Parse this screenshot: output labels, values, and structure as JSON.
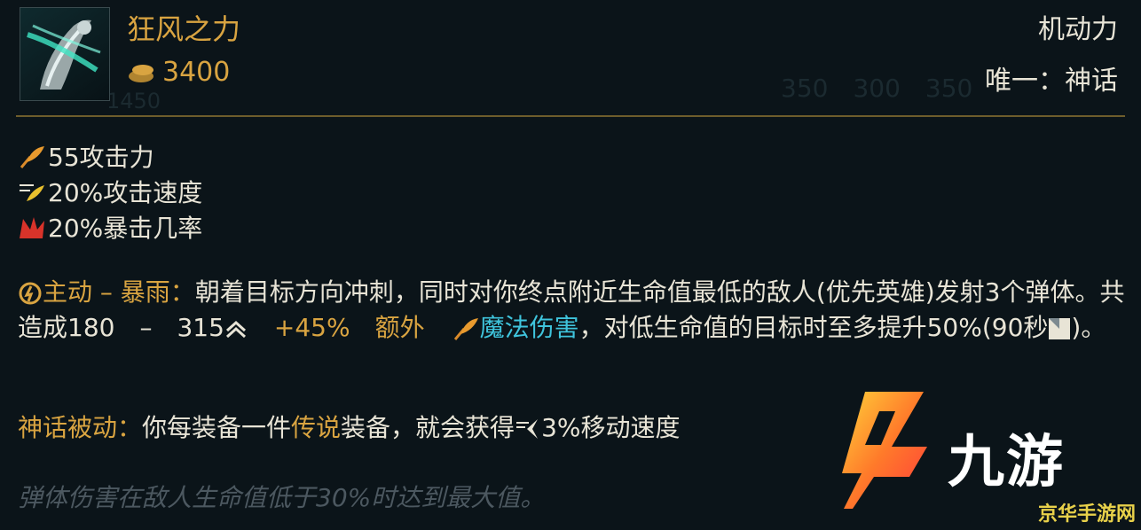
{
  "item": {
    "name": "狂风之力",
    "cost": "3400",
    "category": "机动力",
    "unique_tag": "唯一：神话"
  },
  "stats": [
    {
      "icon": "attack-damage-icon",
      "text": "55攻击力"
    },
    {
      "icon": "attack-speed-icon",
      "text": "20%攻击速度"
    },
    {
      "icon": "critical-chance-icon",
      "text": "20%暴击几率"
    }
  ],
  "active": {
    "label": "主动 – 暴雨：",
    "text1": "朝着目标方向冲刺，同时对你终点附近生命值最低的敌人(优先英雄)发射3个弹体。共造成180　–　315",
    "bonus": "+45%　额外",
    "damage_type": "魔法伤害",
    "text2": "，对低生命值的目标时至多提升50%(90秒",
    "text3": ")。"
  },
  "passive": {
    "label": "神话被动：",
    "text1": "你每装备一件",
    "legendary": "传说",
    "text2": "装备，就会获得",
    "text3": "3%移动速度"
  },
  "flavor": "弹体伤害在敌人生命值低于30%时达到最大值。",
  "watermark": {
    "brand": "九游",
    "site": "京华手游网"
  },
  "colors": {
    "gold": "#d9a441",
    "blue": "#3fc4dc",
    "divider": "#6e5d2c",
    "background": "#0b1419"
  }
}
